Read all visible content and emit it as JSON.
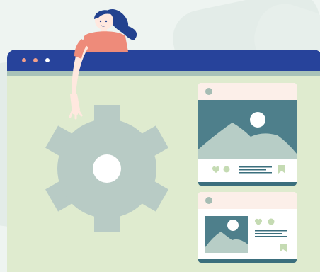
{
  "colors": {
    "titlebar": "#27439b",
    "window_body": "#dfebcf",
    "gear": "#b8cbc5",
    "image_panel": "#4e7f8b",
    "mountains": "#b7cdc6",
    "heart": "#c5dbb3",
    "shirt": "#ee8b7a",
    "hair": "#23428f"
  },
  "window": {
    "controls": [
      "dot",
      "dot",
      "dot"
    ]
  },
  "illustration": {
    "gear_icon": "settings-gear-icon",
    "person": "woman-character",
    "posts": [
      {
        "layout": "large-image",
        "icons": [
          "image-icon",
          "heart-icon",
          "comment-icon",
          "text-lines",
          "bookmark-icon"
        ]
      },
      {
        "layout": "small-image",
        "icons": [
          "image-icon",
          "heart-icon",
          "comment-icon",
          "text-lines",
          "bookmark-icon"
        ]
      }
    ]
  }
}
